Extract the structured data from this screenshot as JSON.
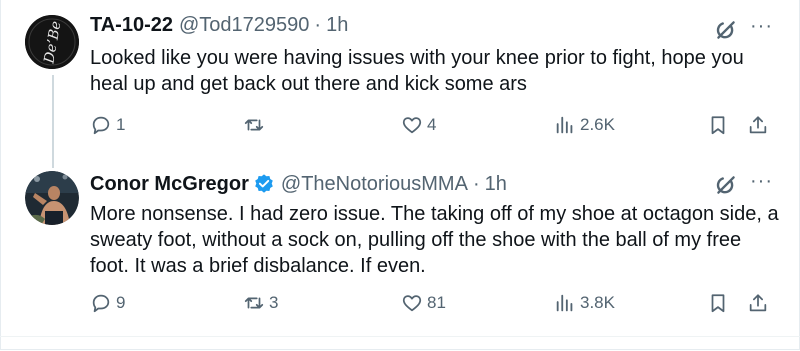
{
  "tweets": [
    {
      "name": "TA-10-22",
      "handle": "@Tod1729590",
      "separator": "·",
      "time": "1h",
      "verified": false,
      "text": "Looked like you were having issues with your knee prior to fight, hope you heal up and get back out there and kick some ars",
      "avatar_text": "De’Be",
      "replies": "1",
      "retweets": "",
      "likes": "4",
      "views": "2.6K",
      "more_label": "···"
    },
    {
      "name": "Conor McGregor",
      "handle": "@TheNotoriousMMA",
      "separator": "·",
      "time": "1h",
      "verified": true,
      "text": "More nonsense. I had zero issue. The taking off of my shoe at octagon side, a sweaty foot, without a sock on, pulling off the shoe with the ball of my free foot. It was a brief disbalance. If even.",
      "replies": "9",
      "retweets": "3",
      "likes": "81",
      "views": "3.8K",
      "more_label": "···"
    }
  ],
  "colors": {
    "text": "#0f1419",
    "secondary": "#536471",
    "verified": "#1d9bf0",
    "thread_line": "#cfd9de"
  },
  "icons": [
    "reply-icon",
    "retweet-icon",
    "like-icon",
    "views-icon",
    "bookmark-icon",
    "share-icon",
    "grok-icon",
    "more-icon",
    "verified-badge-icon"
  ]
}
